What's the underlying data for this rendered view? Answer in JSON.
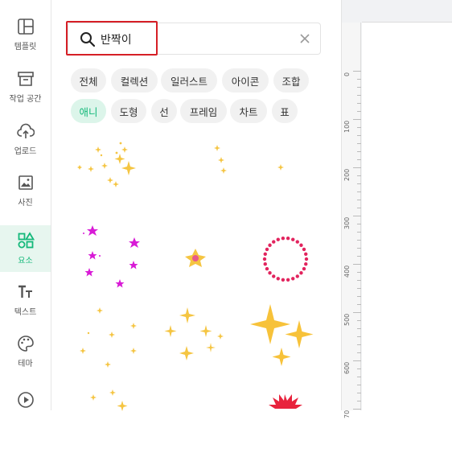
{
  "sidebar": {
    "items": [
      {
        "label": "템플릿",
        "icon": "template-icon",
        "active": false
      },
      {
        "label": "작업 공간",
        "icon": "workspace-icon",
        "active": false
      },
      {
        "label": "업로드",
        "icon": "upload-icon",
        "active": false
      },
      {
        "label": "사진",
        "icon": "photo-icon",
        "active": false
      },
      {
        "label": "요소",
        "icon": "elements-icon",
        "active": true
      },
      {
        "label": "텍스트",
        "icon": "text-icon",
        "active": false
      },
      {
        "label": "테마",
        "icon": "palette-icon",
        "active": false
      },
      {
        "label": "",
        "icon": "play-icon",
        "active": false
      }
    ]
  },
  "search": {
    "value": "반짝이",
    "icon": "search-icon",
    "clear_icon": "close-icon"
  },
  "filters": {
    "chips": [
      "전체",
      "컬렉션",
      "일러스트",
      "아이콘",
      "조합",
      "애니",
      "도형",
      "선",
      "프레임",
      "차트",
      "표"
    ],
    "active": "애니"
  },
  "results": [
    "gold-sparkles-scattered",
    "gold-tiny-sparkles",
    "gold-small-sparkle",
    "magenta-stars",
    "twinkle-star",
    "pink-dot-circle",
    "gold-dot-sparkles",
    "gold-four-point-sparkles",
    "big-gold-sparkles",
    "gold-sparkles-partial",
    "red-burst-partial"
  ],
  "ruler": {
    "labels": [
      "0",
      "100",
      "200",
      "300",
      "400",
      "500",
      "600",
      "70"
    ]
  },
  "colors": {
    "accent": "#14b87a",
    "accent_bg": "#e7f6ef",
    "highlight_border": "#d61f26",
    "sparkle_gold": "#f5c542",
    "star_magenta": "#d81bd6",
    "dot_pink": "#e2245e"
  }
}
